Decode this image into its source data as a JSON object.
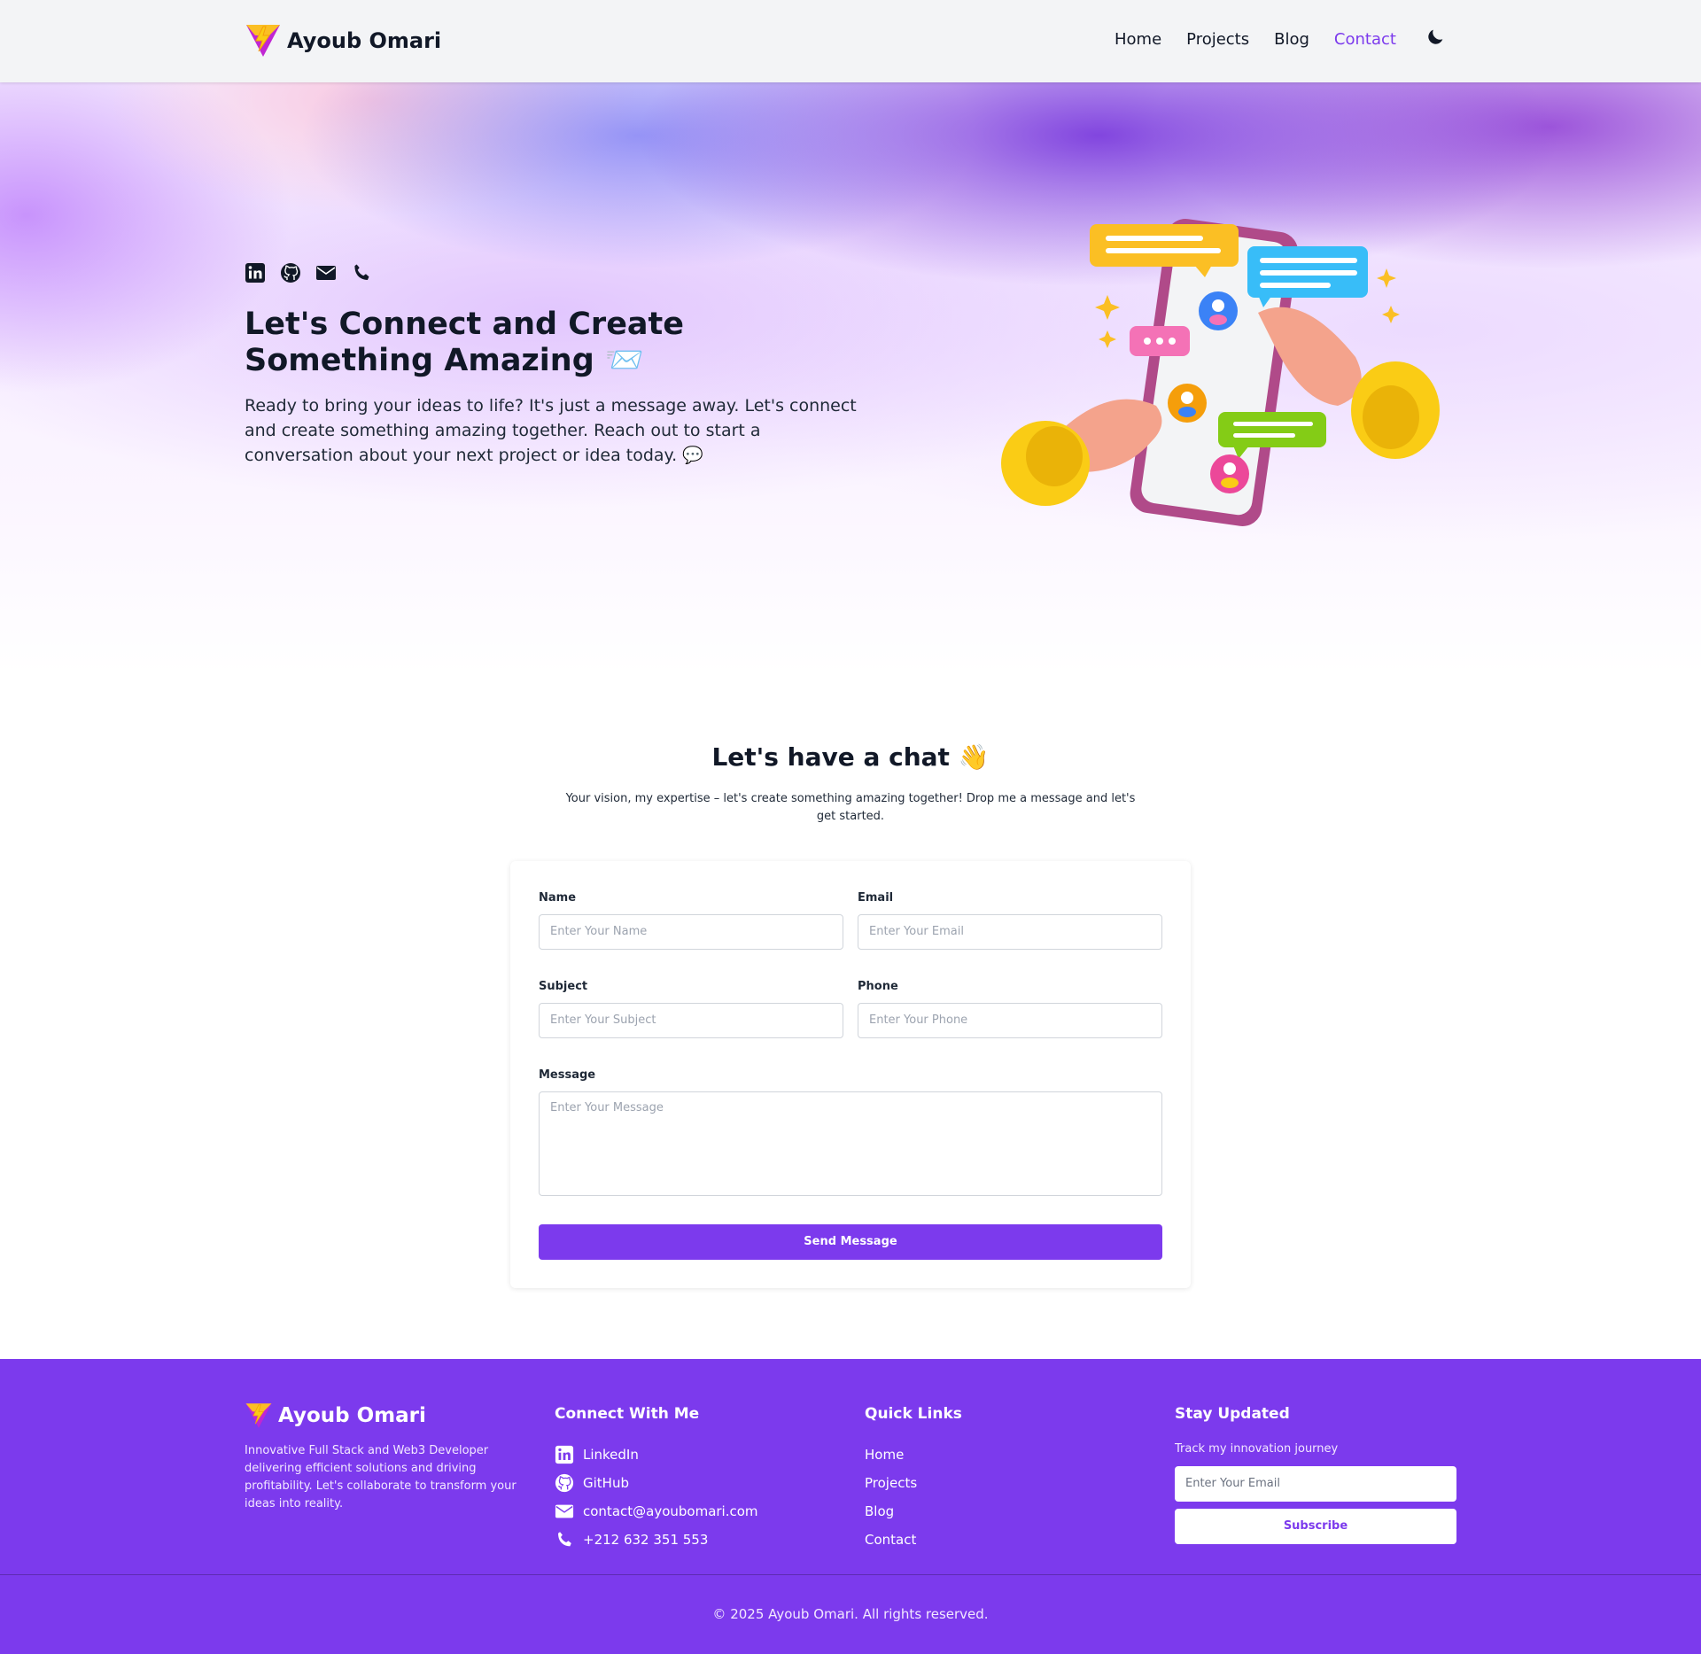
{
  "nav": {
    "brand": "Ayoub Omari",
    "links": [
      "Home",
      "Projects",
      "Blog",
      "Contact"
    ],
    "active_link": "Contact"
  },
  "hero": {
    "icons": [
      "linkedin-icon",
      "github-icon",
      "envelope-icon",
      "phone-icon"
    ],
    "title": "Let's Connect and Create Something Amazing 📨",
    "text": "Ready to bring your ideas to life? It's just a message away. Let's connect and create something amazing together. Reach out to start a conversation about your next project or idea today. 💬"
  },
  "chat": {
    "title": "Let's have a chat 👋",
    "subtitle": "Your vision, my expertise – let's create something amazing together! Drop me a message and let's get started.",
    "form": {
      "name_label": "Name",
      "name_placeholder": "Enter Your Name",
      "email_label": "Email",
      "email_placeholder": "Enter Your Email",
      "subject_label": "Subject",
      "subject_placeholder": "Enter Your Subject",
      "phone_label": "Phone",
      "phone_placeholder": "Enter Your Phone",
      "message_label": "Message",
      "message_placeholder": "Enter Your Message",
      "submit_label": "Send Message"
    }
  },
  "footer": {
    "brand": "Ayoub Omari",
    "description": "Innovative Full Stack and Web3 Developer delivering efficient solutions and driving profitability. Let's collaborate to transform your ideas into reality.",
    "connect_heading": "Connect With Me",
    "connect": [
      {
        "icon": "linkedin-icon",
        "label": "LinkedIn"
      },
      {
        "icon": "github-icon",
        "label": "GitHub"
      },
      {
        "icon": "envelope-icon",
        "label": "contact@ayoubomari.com"
      },
      {
        "icon": "phone-icon",
        "label": "+212 632 351 553"
      }
    ],
    "links_heading": "Quick Links",
    "links": [
      "Home",
      "Projects",
      "Blog",
      "Contact"
    ],
    "newsletter_heading": "Stay Updated",
    "newsletter_text": "Track my innovation journey",
    "newsletter_placeholder": "Enter Your Email",
    "subscribe_label": "Subscribe",
    "copyright": "© 2025 Ayoub Omari. All rights reserved."
  },
  "colors": {
    "accent": "#7c3aed",
    "nav_bg": "#f3f4f6",
    "text_dark": "#111827"
  }
}
